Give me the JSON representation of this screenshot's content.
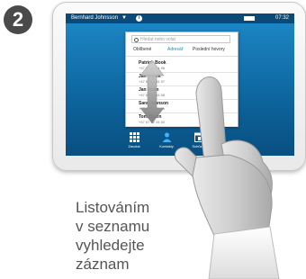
{
  "step": {
    "number": "2"
  },
  "device": {
    "status_bar": {
      "user": "Bernhard Johnsson",
      "caret": "▼",
      "info": "i",
      "clock": "07:32"
    },
    "search": {
      "placeholder": "Hledat nebo volat"
    },
    "tabs": [
      {
        "label": "Oblíbené",
        "active": false
      },
      {
        "label": "Adresář",
        "active": true
      },
      {
        "label": "Poslední hovory",
        "active": false
      }
    ],
    "contacts": [
      {
        "name": "Patrick Book",
        "sub": "+47 67 12 34 56"
      },
      {
        "name": "Jan Vojtek",
        "sub": "+47 67 12 34 57"
      },
      {
        "name": "Jan Holm",
        "sub": "+47 67 12 34 58"
      },
      {
        "name": "Sara Johnson",
        "sub": "+47 67 12 34 59"
      },
      {
        "name": "Tom Olsen",
        "sub": "+47 67 12 34 60"
      }
    ],
    "nav": [
      {
        "label": "Zavolat"
      },
      {
        "label": "Kontakty"
      },
      {
        "label": "Schůzky"
      }
    ]
  },
  "caption": {
    "lines": [
      "Listováním",
      "v seznamu",
      "vyhledejte",
      "záznam"
    ]
  },
  "colors": {
    "accent": "#1a8fd6",
    "screen": "#0b5f96",
    "badge": "#4a4a4a"
  }
}
